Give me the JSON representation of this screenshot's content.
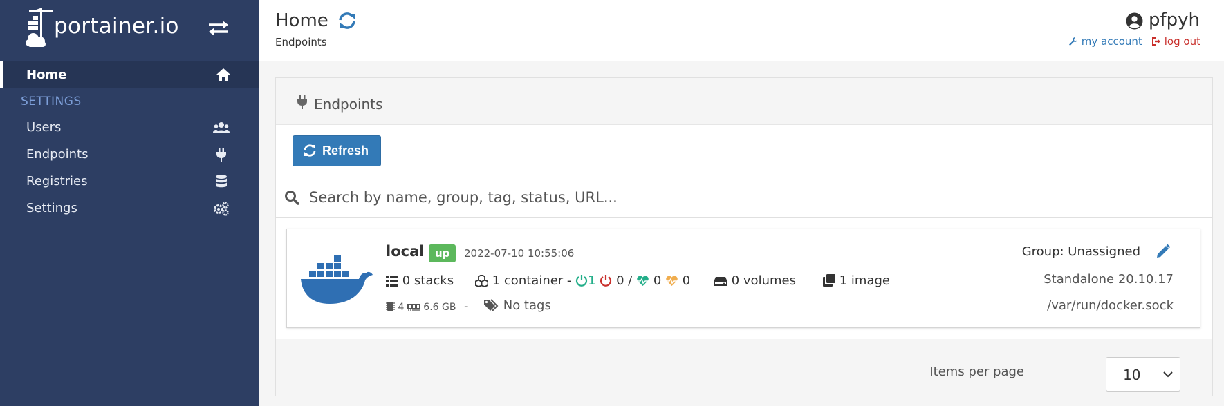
{
  "app": {
    "logo_text": "portainer.io"
  },
  "sidebar": {
    "home_label": "Home",
    "settings_heading": "SETTINGS",
    "items": [
      {
        "label": "Users",
        "icon": "users-icon"
      },
      {
        "label": "Endpoints",
        "icon": "plug-icon"
      },
      {
        "label": "Registries",
        "icon": "database-icon"
      },
      {
        "label": "Settings",
        "icon": "cogs-icon"
      }
    ]
  },
  "header": {
    "title": "Home",
    "breadcrumb": "Endpoints",
    "username": "pfpyh",
    "my_account_label": " my account",
    "logout_label": " log out"
  },
  "panel": {
    "title": "Endpoints",
    "refresh_label": "Refresh",
    "search_placeholder": "Search by name, group, tag, status, URL..."
  },
  "endpoint": {
    "name": "local",
    "status": "up",
    "timestamp": "2022-07-10 10:55:06",
    "stacks": "0 stacks",
    "containers": "1 container -",
    "running": "1",
    "stopped": "0",
    "separator": "/",
    "healthy": "0",
    "unhealthy": "0",
    "volumes": "0 volumes",
    "images": "1 image",
    "cpu": "4",
    "memory": "6.6 GB",
    "dash": "-",
    "tags": "No tags",
    "group": "Group: Unassigned",
    "version": "Standalone 20.10.17",
    "url": "/var/run/docker.sock"
  },
  "pagination": {
    "items_per_page_label": "Items per page",
    "items_per_page_value": "10"
  },
  "colors": {
    "sidebar_bg": "#2d3e63",
    "primary": "#337ab7",
    "success": "#5cb85c",
    "docker_blue": "#2f6fb3"
  }
}
